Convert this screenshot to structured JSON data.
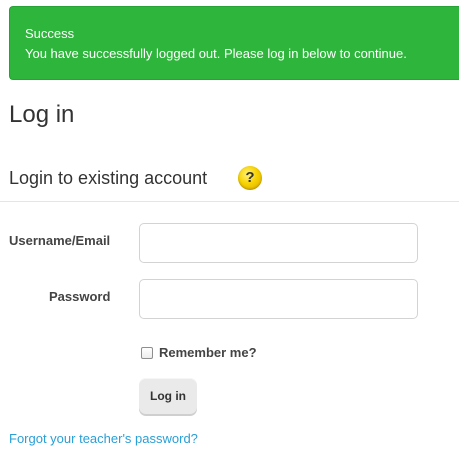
{
  "alert": {
    "title": "Success",
    "message": "You have successfully logged out. Please log in below to continue.",
    "color": "#2db63b"
  },
  "page_title": "Log in",
  "login_section": {
    "heading": "Login to existing account",
    "help_icon": "question-icon",
    "help_glyph": "?"
  },
  "form": {
    "username_label": "Username/Email",
    "username_value": "",
    "password_label": "Password",
    "password_value": "",
    "remember_label": "Remember me?",
    "remember_checked": false,
    "submit_label": "Log in"
  },
  "forgot_link": "Forgot your teacher's password?",
  "colors": {
    "link": "#2a9fd6",
    "help_icon": "#f7d200"
  }
}
